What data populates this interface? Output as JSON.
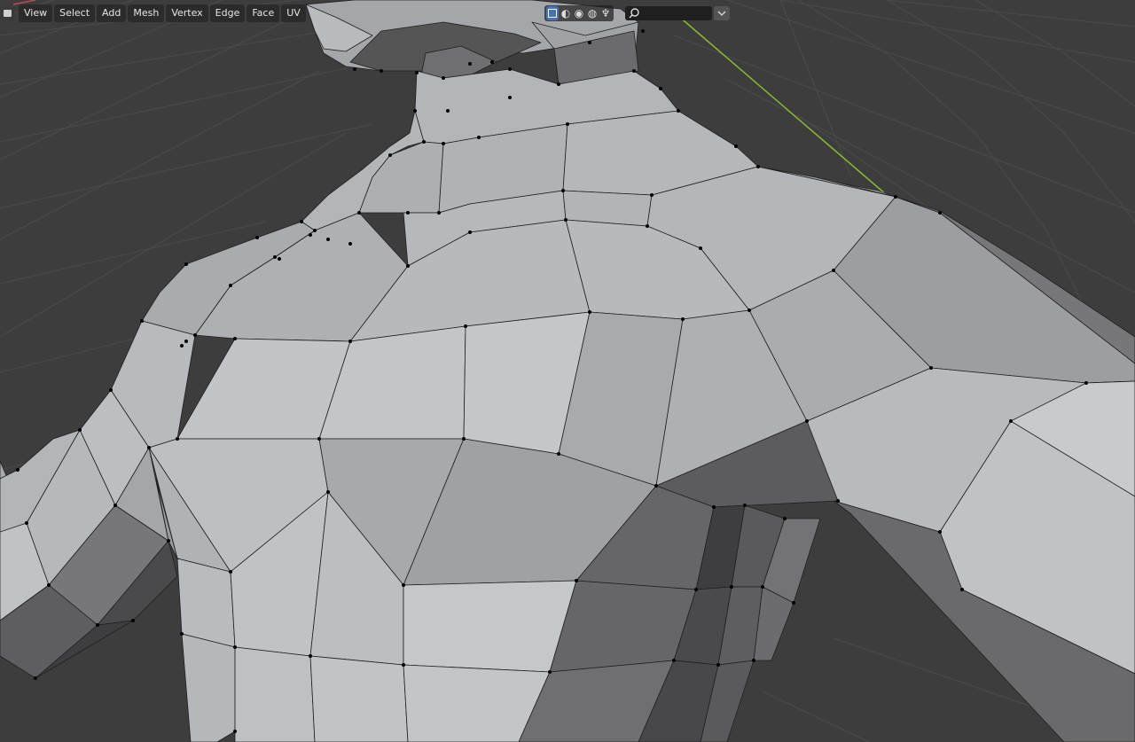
{
  "app": "Blender",
  "header": {
    "menus": [
      "View",
      "Select",
      "Add",
      "Mesh",
      "Vertex",
      "Edge",
      "Face",
      "UV"
    ],
    "shading_modes": [
      "wireframe-icon",
      "solid-icon",
      "material-preview-icon",
      "rendered-icon"
    ],
    "active_shading": "solid-icon",
    "search": {
      "value": "",
      "placeholder": ""
    }
  },
  "colors": {
    "background": "#3d3d3d",
    "grid": "#4a4a4a",
    "y_axis": "#8db830",
    "x_axis": "#b94a5a",
    "mesh_light": "#b5b7ba",
    "mesh_mid": "#9b9da0",
    "mesh_dark": "#5f5f61",
    "mesh_darkest": "#454547",
    "edge": "#1a1a1a",
    "vertex": "#000000",
    "active_shading": "#4772b3"
  },
  "scene": {
    "mode": "Edit Mode",
    "object": "Human torso mesh (neck, chest, shoulders, arms)"
  }
}
